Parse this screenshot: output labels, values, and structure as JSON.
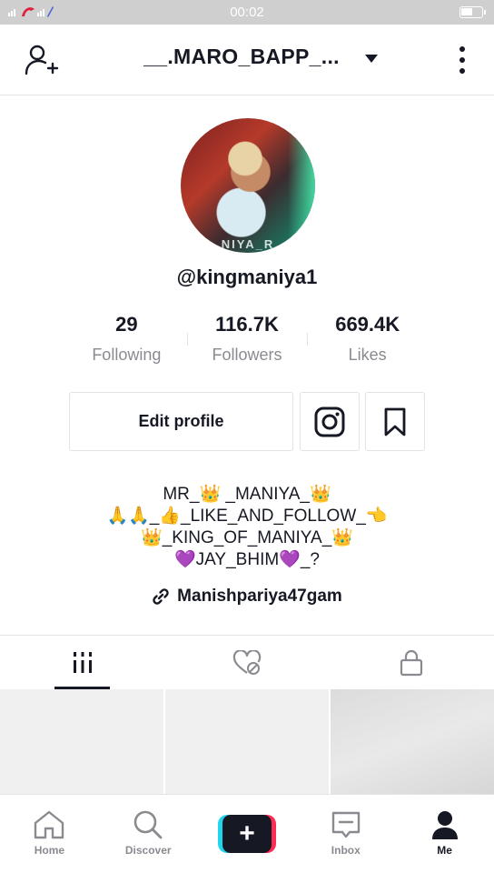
{
  "status_bar": {
    "time": "00:02"
  },
  "header": {
    "title": "__.MARO_BAPP_..."
  },
  "profile": {
    "username": "@kingmaniya1",
    "avatar_text": "NIYA_R"
  },
  "stats": [
    {
      "value": "29",
      "label": "Following"
    },
    {
      "value": "116.7K",
      "label": "Followers"
    },
    {
      "value": "669.4K",
      "label": "Likes"
    }
  ],
  "actions": {
    "edit_profile_label": "Edit profile"
  },
  "bio": {
    "lines": [
      "MR_👑 _MANIYA_👑",
      "🙏🙏_👍_LIKE_AND_FOLLOW_👈",
      "👑_KING_OF_MANIYA_👑",
      "💜JAY_BHIM💜_?"
    ]
  },
  "link": {
    "text": "Manishpariya47gam"
  },
  "bottom_nav": {
    "items": [
      {
        "label": "Home",
        "icon": "home-icon"
      },
      {
        "label": "Discover",
        "icon": "search-icon"
      },
      {
        "label": "",
        "icon": "plus-icon"
      },
      {
        "label": "Inbox",
        "icon": "inbox-icon"
      },
      {
        "label": "Me",
        "icon": "person-icon",
        "active": true
      }
    ]
  },
  "colors": {
    "accent_cyan": "#20d5ec",
    "accent_red": "#fe2c55",
    "text": "#161823",
    "muted": "#8a8b91"
  }
}
